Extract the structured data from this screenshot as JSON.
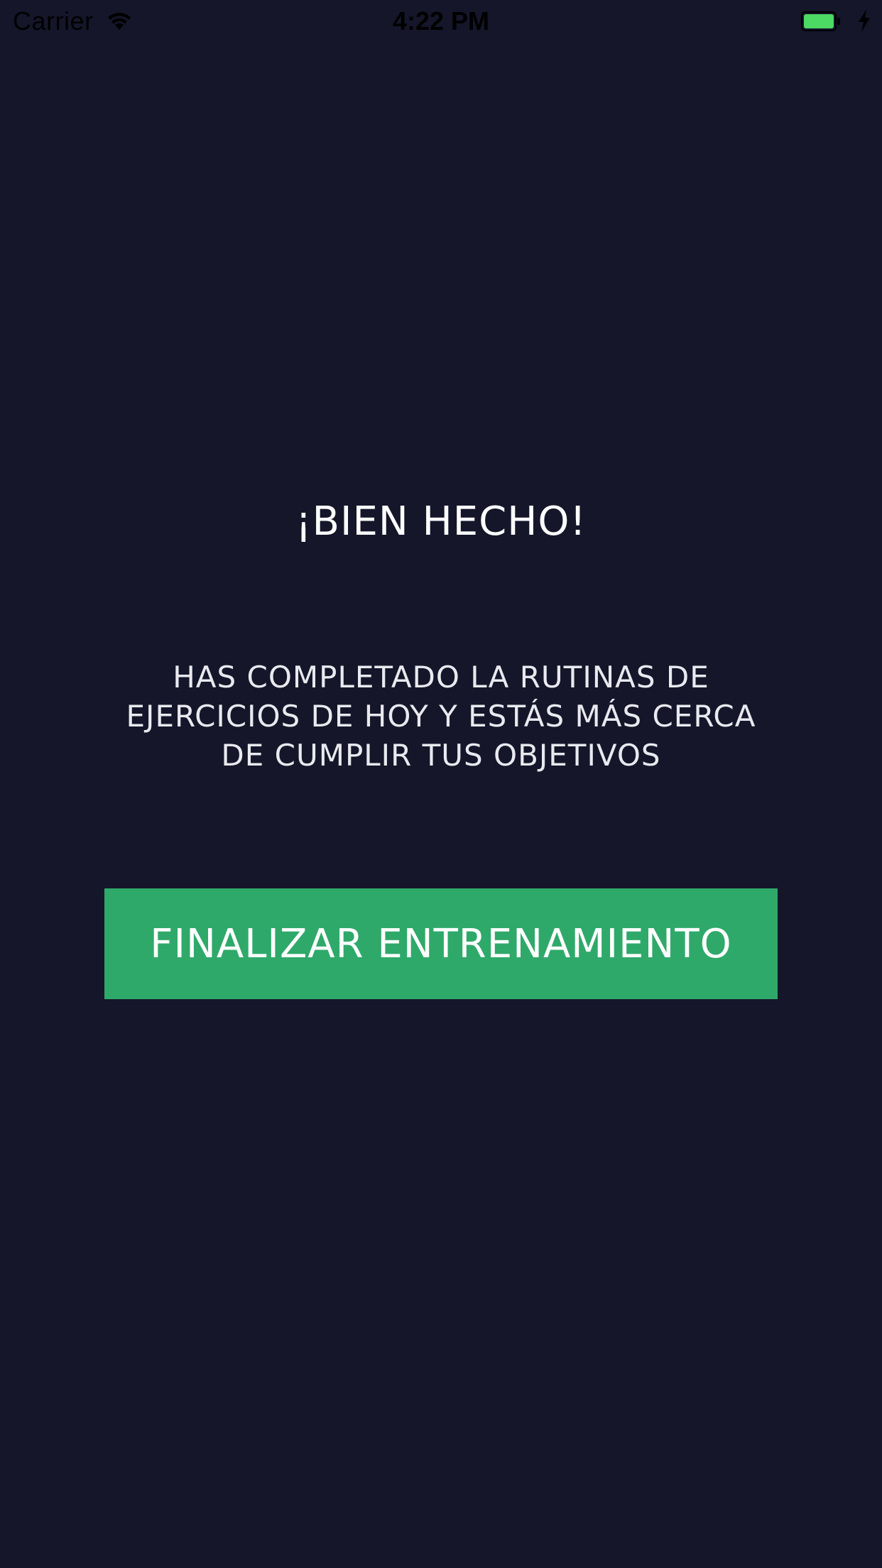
{
  "status_bar": {
    "carrier": "Carrier",
    "time": "4:22 PM",
    "icons": [
      "wifi-icon",
      "battery-icon",
      "charging-bolt-icon"
    ],
    "battery_color": "#4cd964"
  },
  "content": {
    "title": "¡BIEN HECHO!",
    "message": "HAS COMPLETADO LA RUTINAS DE EJERCICIOS DE HOY Y ESTÁS MÁS CERCA DE CUMPLIR TUS OBJETIVOS",
    "finish_button_label": "FINALIZAR ENTRENAMIENTO"
  },
  "colors": {
    "background": "#15162a",
    "accent": "#2fa96a",
    "text": "#ffffff"
  }
}
